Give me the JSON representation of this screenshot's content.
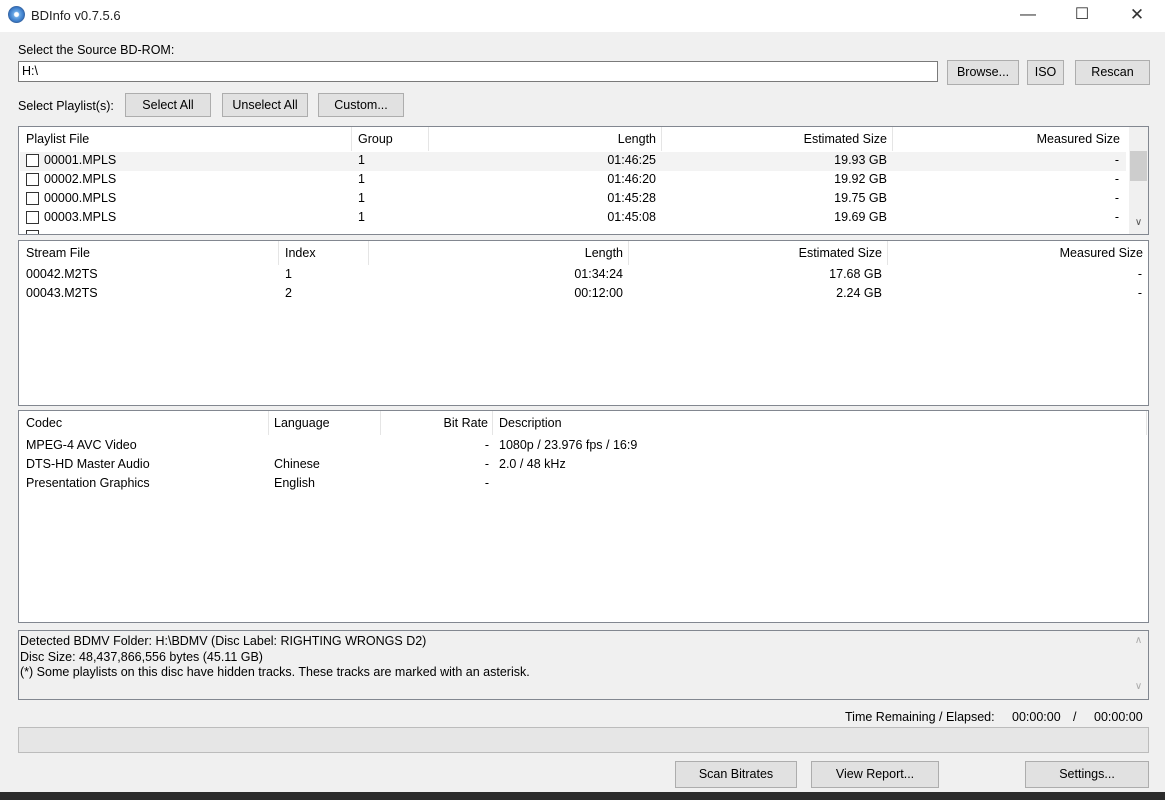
{
  "window": {
    "title": "BDInfo v0.7.5.6",
    "minimize": "—",
    "maximize": "☐",
    "close": "✕"
  },
  "source": {
    "label": "Select the Source BD-ROM:",
    "path": "H:\\",
    "browse": "Browse...",
    "iso": "ISO",
    "rescan": "Rescan"
  },
  "playlist_select": {
    "label": "Select Playlist(s):",
    "select_all": "Select All",
    "unselect_all": "Unselect All",
    "custom": "Custom..."
  },
  "playlists": {
    "headers": [
      "Playlist File",
      "Group",
      "Length",
      "Estimated Size",
      "Measured Size"
    ],
    "rows": [
      [
        "00001.MPLS",
        "1",
        "01:46:25",
        "19.93 GB",
        "-"
      ],
      [
        "00002.MPLS",
        "1",
        "01:46:20",
        "19.92 GB",
        "-"
      ],
      [
        "00000.MPLS",
        "1",
        "01:45:28",
        "19.75 GB",
        "-"
      ],
      [
        "00003.MPLS",
        "1",
        "01:45:08",
        "19.69 GB",
        "-"
      ]
    ]
  },
  "streams": {
    "headers": [
      "Stream File",
      "Index",
      "Length",
      "Estimated Size",
      "Measured Size"
    ],
    "rows": [
      [
        "00042.M2TS",
        "1",
        "01:34:24",
        "17.68 GB",
        "-"
      ],
      [
        "00043.M2TS",
        "2",
        "00:12:00",
        "2.24 GB",
        "-"
      ]
    ]
  },
  "codecs": {
    "headers": [
      "Codec",
      "Language",
      "Bit Rate",
      "Description"
    ],
    "rows": [
      [
        "MPEG-4 AVC Video",
        "",
        "-",
        "1080p / 23.976 fps / 16:9"
      ],
      [
        "DTS-HD Master Audio",
        "Chinese",
        "-",
        "2.0 / 48 kHz"
      ],
      [
        "Presentation Graphics",
        "English",
        "-",
        ""
      ]
    ]
  },
  "info": {
    "lines": [
      "Detected BDMV Folder: H:\\BDMV (Disc Label: RIGHTING WRONGS D2)",
      "Disc Size: 48,437,866,556 bytes (45.11 GB)",
      "(*) Some playlists on this disc have hidden tracks. These tracks are marked with an asterisk."
    ]
  },
  "status": {
    "time_label": "Time Remaining / Elapsed:",
    "remaining": "00:00:00",
    "slash": "/",
    "elapsed": "00:00:00",
    "progress": 0
  },
  "footer": {
    "scan": "Scan Bitrates",
    "report": "View Report...",
    "settings": "Settings..."
  }
}
